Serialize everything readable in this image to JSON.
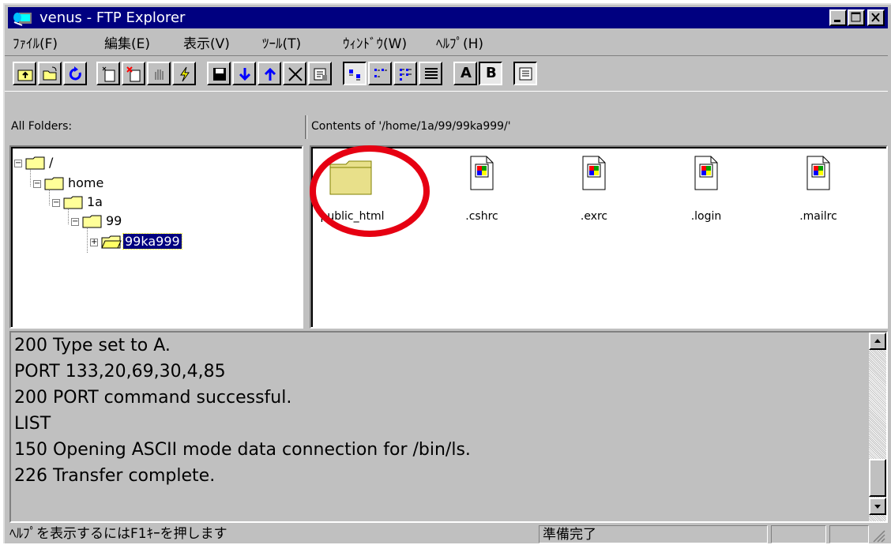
{
  "window": {
    "title": "venus - FTP Explorer"
  },
  "menu": [
    "ﾌｧｲﾙ(F)",
    "編集(E)",
    "表示(V)",
    "ﾂｰﾙ(T)",
    "ｳｨﾝﾄﾞｳ(W)",
    "ﾍﾙﾌﾟ(H)"
  ],
  "toolbar": {
    "buttons": [
      "up-folder-icon",
      "open-icon",
      "refresh-icon",
      "new-folder-icon",
      "delete-folder-icon",
      "stop-icon",
      "connect-icon",
      "save-icon",
      "download-icon",
      "upload-icon",
      "delete-icon",
      "properties-icon",
      "large-icons-icon",
      "small-icons-icon",
      "list-icon",
      "details-icon",
      "ascii-mode",
      "binary-mode",
      "log-view-icon"
    ],
    "ascii_label": "A",
    "binary_label": "B"
  },
  "left_pane": {
    "label": "All Folders:",
    "tree": [
      {
        "label": "/",
        "level": 0,
        "expander": "⊟"
      },
      {
        "label": "home",
        "level": 1,
        "expander": "⊟"
      },
      {
        "label": "1a",
        "level": 2,
        "expander": "⊟"
      },
      {
        "label": "99",
        "level": 3,
        "expander": "⊟"
      },
      {
        "label": "99ka999",
        "level": 4,
        "expander": "⊞",
        "selected": true
      }
    ]
  },
  "right_pane": {
    "label": "Contents of '/home/1a/99/99ka999/'",
    "items": [
      {
        "name": "public_html",
        "type": "folder",
        "highlighted": true
      },
      {
        "name": ".cshrc",
        "type": "file"
      },
      {
        "name": ".exrc",
        "type": "file"
      },
      {
        "name": ".login",
        "type": "file"
      },
      {
        "name": ".mailrc",
        "type": "file"
      }
    ]
  },
  "log": {
    "lines": [
      "200 Type set to A.",
      "PORT 133,20,69,30,4,85",
      "200 PORT command successful.",
      "LIST",
      "150 Opening ASCII mode data connection for /bin/ls.",
      "226 Transfer complete."
    ]
  },
  "status": {
    "help_text": "ﾍﾙﾌﾟを表示するにはF1ｷｰを押します",
    "ready": "準備完了"
  },
  "colors": {
    "titlebar": "#000080",
    "face": "#c0c0c0",
    "selection": "#000080",
    "highlight_circle": "#e60012",
    "folder": "#e8e08a"
  }
}
